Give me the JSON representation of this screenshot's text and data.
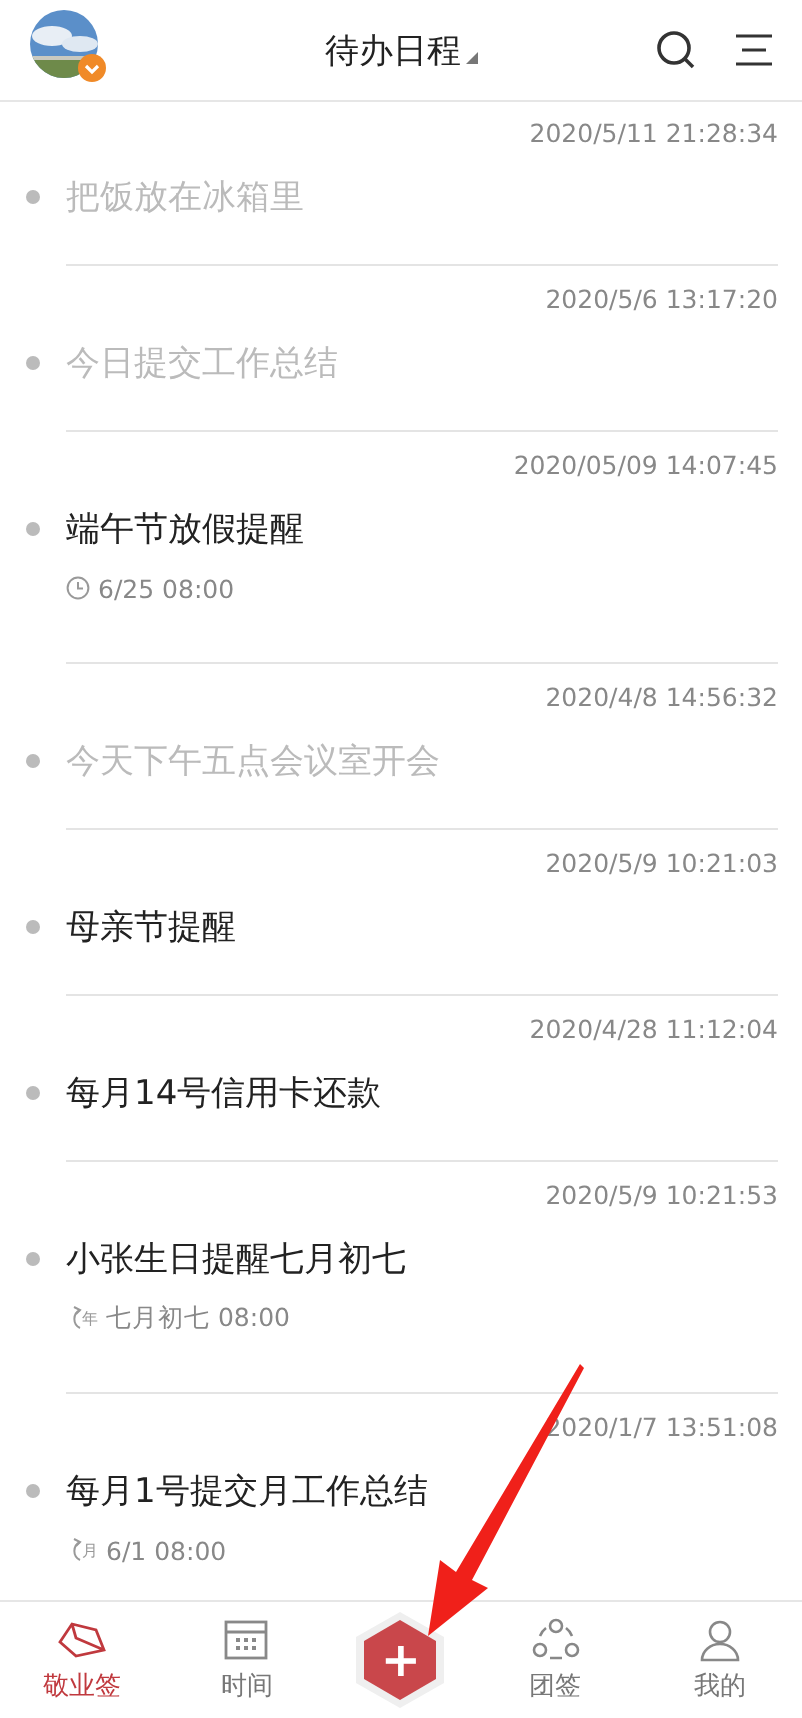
{
  "header": {
    "title": "待办日程"
  },
  "items": [
    {
      "timestamp": "2020/5/11 21:28:34",
      "title": "把饭放在冰箱里",
      "done": true
    },
    {
      "timestamp": "2020/5/6 13:17:20",
      "title": "今日提交工作总结",
      "done": true
    },
    {
      "timestamp": "2020/05/09 14:07:45",
      "title": "端午节放假提醒",
      "done": false,
      "reminder": {
        "kind": "clock",
        "text": "6/25 08:00"
      }
    },
    {
      "timestamp": "2020/4/8 14:56:32",
      "title": "今天下午五点会议室开会",
      "done": true
    },
    {
      "timestamp": "2020/5/9 10:21:03",
      "title": "母亲节提醒",
      "done": false
    },
    {
      "timestamp": "2020/4/28 11:12:04",
      "title": "每月14号信用卡还款",
      "done": false
    },
    {
      "timestamp": "2020/5/9 10:21:53",
      "title": "小张生日提醒七月初七",
      "done": false,
      "reminder": {
        "kind": "repeat",
        "tag": "年",
        "text": "七月初七 08:00"
      }
    },
    {
      "timestamp": "2020/1/7 13:51:08",
      "title": "每月1号提交月工作总结",
      "done": false,
      "reminder": {
        "kind": "repeat",
        "tag": "月",
        "text": "6/1 08:00"
      }
    }
  ],
  "nav": [
    {
      "kind": "notes",
      "label": "敬业签",
      "selected": true
    },
    {
      "kind": "calendar",
      "label": "时间",
      "selected": false
    },
    {
      "kind": "add",
      "label": "+"
    },
    {
      "kind": "team",
      "label": "团签",
      "selected": false
    },
    {
      "kind": "person",
      "label": "我的",
      "selected": false
    }
  ]
}
